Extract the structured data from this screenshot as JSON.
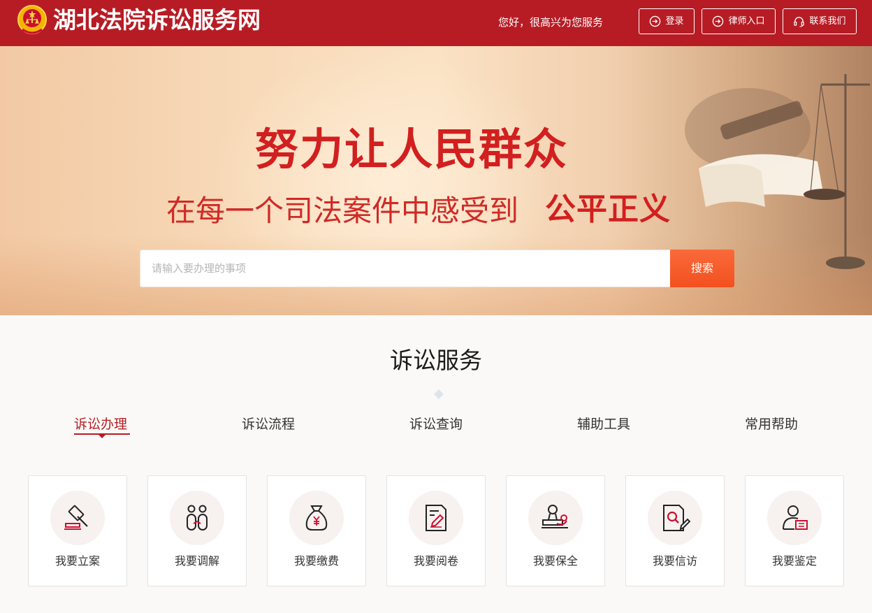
{
  "header": {
    "site_title": "湖北法院诉讼服务网",
    "greeting": "您好，很高兴为您服务",
    "login_label": "登录",
    "lawyer_label": "律师入口",
    "contact_label": "联系我们",
    "brand_color": "#b71c25"
  },
  "banner": {
    "headline1": "努力让人民群众",
    "headline2": "在每一个司法案件中感受到",
    "headline2_strong": "公平正义",
    "search_placeholder": "请输入要办理的事项",
    "search_button": "搜索"
  },
  "services": {
    "title": "诉讼服务",
    "tabs": [
      {
        "label": "诉讼办理",
        "active": true
      },
      {
        "label": "诉讼流程",
        "active": false
      },
      {
        "label": "诉讼查询",
        "active": false
      },
      {
        "label": "辅助工具",
        "active": false
      },
      {
        "label": "常用帮助",
        "active": false
      }
    ],
    "cards": [
      {
        "label": "我要立案",
        "icon": "gavel-icon"
      },
      {
        "label": "我要调解",
        "icon": "mediation-icon"
      },
      {
        "label": "我要缴费",
        "icon": "money-bag-icon"
      },
      {
        "label": "我要阅卷",
        "icon": "document-edit-icon"
      },
      {
        "label": "我要保全",
        "icon": "seal-icon"
      },
      {
        "label": "我要信访",
        "icon": "document-search-icon"
      },
      {
        "label": "我要鉴定",
        "icon": "user-id-icon"
      }
    ]
  }
}
